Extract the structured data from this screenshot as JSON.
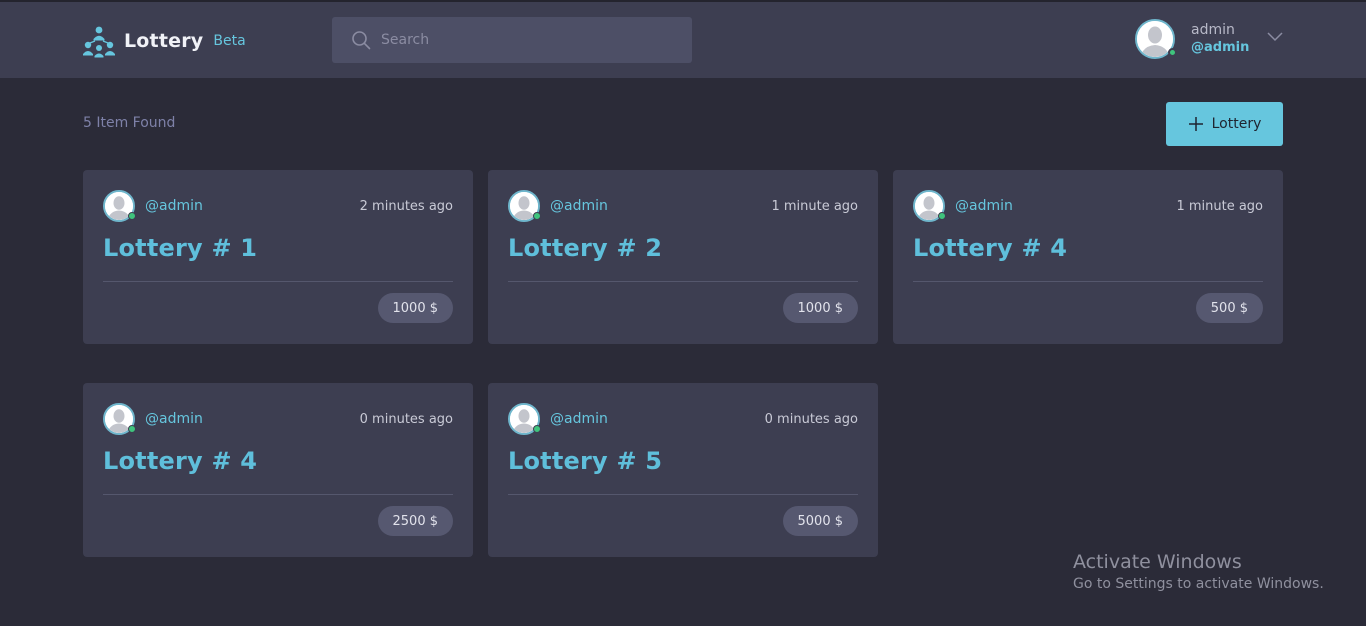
{
  "header": {
    "brand_name": "Lottery",
    "brand_badge": "Beta",
    "search_placeholder": "Search",
    "user_name": "admin",
    "user_handle": "@admin"
  },
  "toolbar": {
    "found_text": "5 Item Found",
    "add_label": "Lottery"
  },
  "cards": [
    {
      "handle": "@admin",
      "time": "2 minutes ago",
      "title": "Lottery # 1",
      "price": "1000 $"
    },
    {
      "handle": "@admin",
      "time": "1 minute ago",
      "title": "Lottery # 2",
      "price": "1000 $"
    },
    {
      "handle": "@admin",
      "time": "1 minute ago",
      "title": "Lottery # 4",
      "price": "500 $"
    },
    {
      "handle": "@admin",
      "time": "0 minutes ago",
      "title": "Lottery # 4",
      "price": "2500 $"
    },
    {
      "handle": "@admin",
      "time": "0 minutes ago",
      "title": "Lottery # 5",
      "price": "5000 $"
    }
  ],
  "watermark": {
    "title": "Activate Windows",
    "subtitle": "Go to Settings to activate Windows."
  },
  "colors": {
    "background": "#2b2b38",
    "surface": "#3d3e51",
    "accent": "#66c6de",
    "online": "#3fc47d"
  },
  "icons": [
    "logo-icon",
    "search-icon",
    "avatar-icon",
    "chevron-down-icon",
    "plus-icon"
  ]
}
